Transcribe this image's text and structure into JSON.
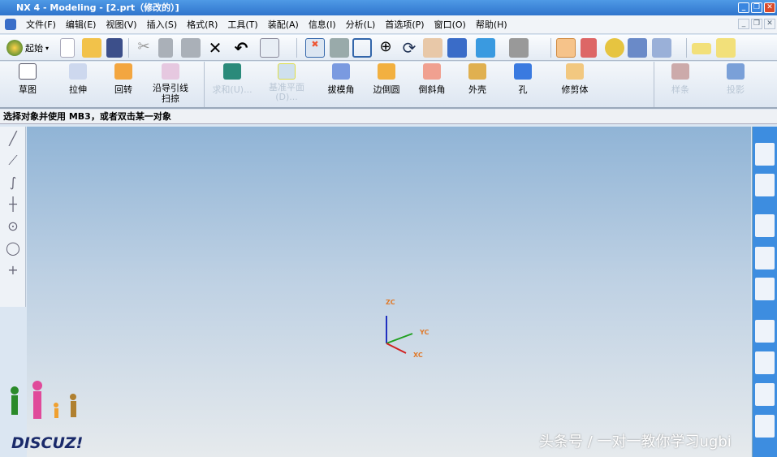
{
  "window": {
    "title": "NX 4 - Modeling - [2.prt（修改的）]",
    "minimize": "_",
    "restore": "❐",
    "close": "✕"
  },
  "menu": [
    "文件(F)",
    "编辑(E)",
    "视图(V)",
    "插入(S)",
    "格式(R)",
    "工具(T)",
    "装配(A)",
    "信息(I)",
    "分析(L)",
    "首选项(P)",
    "窗口(O)",
    "帮助(H)"
  ],
  "toolbar": {
    "start_label": "起始"
  },
  "features": [
    {
      "label": "草图"
    },
    {
      "label": "拉伸"
    },
    {
      "label": "回转"
    },
    {
      "label": "沿导引线\n扫掠"
    },
    {
      "label": "求和(U)..."
    },
    {
      "label": "基准平面\n(D)..."
    },
    {
      "label": "拔模角"
    },
    {
      "label": "边倒圆"
    },
    {
      "label": "倒斜角"
    },
    {
      "label": "外壳"
    },
    {
      "label": "孔"
    },
    {
      "label": "修剪体"
    },
    {
      "label": "样条"
    },
    {
      "label": "投影"
    }
  ],
  "status": {
    "prompt": "选择对象并使用 MB3，或者双击某一对象"
  },
  "axes": {
    "z": "ZC",
    "y": "YC",
    "x": "XC"
  },
  "watermark": {
    "text": "头条号 / 一对一教你学习ugbi",
    "logo": "DISCUZ!"
  },
  "colors": {
    "title": "#2f74cc",
    "accent_selected": "#f6c38a",
    "right_bar": "#3d8de0"
  }
}
